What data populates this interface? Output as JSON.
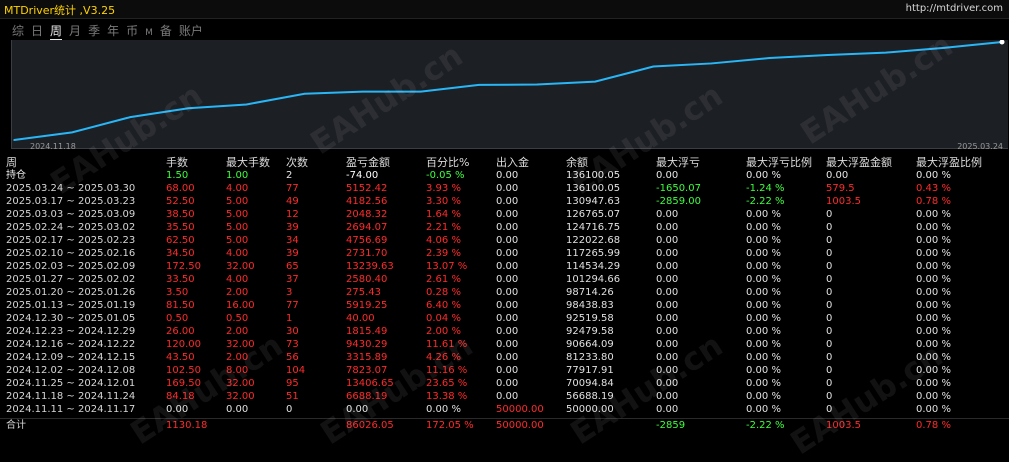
{
  "app": {
    "title": "MTDriver统计 ,V3.25",
    "url": "http://mtdriver.com"
  },
  "tabs": [
    {
      "label": "综",
      "active": false
    },
    {
      "label": "日",
      "active": false
    },
    {
      "label": "周",
      "active": true
    },
    {
      "label": "月",
      "active": false
    },
    {
      "label": "季",
      "active": false
    },
    {
      "label": "年",
      "active": false
    },
    {
      "label": "币",
      "active": false
    },
    {
      "label": "M",
      "active": false
    },
    {
      "label": "备",
      "active": false
    },
    {
      "label": "账户",
      "active": false
    }
  ],
  "chart_data": {
    "type": "line",
    "x_start_label": "2024.11.18",
    "x_end_label": "2025.03.24",
    "line_color": "#29b6f6",
    "background": "#1c1f24",
    "values": [
      50000.0,
      56688.19,
      70094.84,
      77917.91,
      81233.8,
      90664.09,
      92479.58,
      92519.58,
      98438.83,
      98714.26,
      101294.66,
      114534.29,
      117265.99,
      122022.68,
      124716.75,
      126765.07,
      130947.63,
      136100.05
    ]
  },
  "watermark": "EAHub.cn",
  "table": {
    "headers": [
      "周",
      "手数",
      "最大手数",
      "次数",
      "盈亏金额",
      "百分比%",
      "出入金",
      "余额",
      "最大浮亏",
      "最大浮亏比例",
      "最大浮盈金额",
      "最大浮盈比例"
    ],
    "holding": [
      "持仓",
      "1.50",
      "1.00",
      "2",
      "-74.00",
      "-0.05 %",
      "0.00",
      "136100.05",
      "0.00",
      "0.00 %",
      "0.00",
      "0.00 %"
    ],
    "rows": [
      [
        "2025.03.24 ~ 2025.03.30",
        "68.00",
        "4.00",
        "77",
        "5152.42",
        "3.93 %",
        "0.00",
        "136100.05",
        "-1650.07",
        "-1.24 %",
        "579.5",
        "0.43 %"
      ],
      [
        "2025.03.17 ~ 2025.03.23",
        "52.50",
        "5.00",
        "49",
        "4182.56",
        "3.30 %",
        "0.00",
        "130947.63",
        "-2859.00",
        "-2.22 %",
        "1003.5",
        "0.78 %"
      ],
      [
        "2025.03.03 ~ 2025.03.09",
        "38.50",
        "5.00",
        "12",
        "2048.32",
        "1.64 %",
        "0.00",
        "126765.07",
        "0.00",
        "0.00 %",
        "0",
        "0.00 %"
      ],
      [
        "2025.02.24 ~ 2025.03.02",
        "35.50",
        "5.00",
        "39",
        "2694.07",
        "2.21 %",
        "0.00",
        "124716.75",
        "0.00",
        "0.00 %",
        "0",
        "0.00 %"
      ],
      [
        "2025.02.17 ~ 2025.02.23",
        "62.50",
        "5.00",
        "34",
        "4756.69",
        "4.06 %",
        "0.00",
        "122022.68",
        "0.00",
        "0.00 %",
        "0",
        "0.00 %"
      ],
      [
        "2025.02.10 ~ 2025.02.16",
        "34.50",
        "4.00",
        "39",
        "2731.70",
        "2.39 %",
        "0.00",
        "117265.99",
        "0.00",
        "0.00 %",
        "0",
        "0.00 %"
      ],
      [
        "2025.02.03 ~ 2025.02.09",
        "172.50",
        "32.00",
        "65",
        "13239.63",
        "13.07 %",
        "0.00",
        "114534.29",
        "0.00",
        "0.00 %",
        "0",
        "0.00 %"
      ],
      [
        "2025.01.27 ~ 2025.02.02",
        "33.50",
        "4.00",
        "37",
        "2580.40",
        "2.61 %",
        "0.00",
        "101294.66",
        "0.00",
        "0.00 %",
        "0",
        "0.00 %"
      ],
      [
        "2025.01.20 ~ 2025.01.26",
        "3.50",
        "2.00",
        "3",
        "275.43",
        "0.28 %",
        "0.00",
        "98714.26",
        "0.00",
        "0.00 %",
        "0",
        "0.00 %"
      ],
      [
        "2025.01.13 ~ 2025.01.19",
        "81.50",
        "16.00",
        "77",
        "5919.25",
        "6.40 %",
        "0.00",
        "98438.83",
        "0.00",
        "0.00 %",
        "0",
        "0.00 %"
      ],
      [
        "2024.12.30 ~ 2025.01.05",
        "0.50",
        "0.50",
        "1",
        "40.00",
        "0.04 %",
        "0.00",
        "92519.58",
        "0.00",
        "0.00 %",
        "0",
        "0.00 %"
      ],
      [
        "2024.12.23 ~ 2024.12.29",
        "26.00",
        "2.00",
        "30",
        "1815.49",
        "2.00 %",
        "0.00",
        "92479.58",
        "0.00",
        "0.00 %",
        "0",
        "0.00 %"
      ],
      [
        "2024.12.16 ~ 2024.12.22",
        "120.00",
        "32.00",
        "73",
        "9430.29",
        "11.61 %",
        "0.00",
        "90664.09",
        "0.00",
        "0.00 %",
        "0",
        "0.00 %"
      ],
      [
        "2024.12.09 ~ 2024.12.15",
        "43.50",
        "2.00",
        "56",
        "3315.89",
        "4.26 %",
        "0.00",
        "81233.80",
        "0.00",
        "0.00 %",
        "0",
        "0.00 %"
      ],
      [
        "2024.12.02 ~ 2024.12.08",
        "102.50",
        "8.00",
        "104",
        "7823.07",
        "11.16 %",
        "0.00",
        "77917.91",
        "0.00",
        "0.00 %",
        "0",
        "0.00 %"
      ],
      [
        "2024.11.25 ~ 2024.12.01",
        "169.50",
        "32.00",
        "95",
        "13406.65",
        "23.65 %",
        "0.00",
        "70094.84",
        "0.00",
        "0.00 %",
        "0",
        "0.00 %"
      ],
      [
        "2024.11.18 ~ 2024.11.24",
        "84.18",
        "32.00",
        "51",
        "6688.19",
        "13.38 %",
        "0.00",
        "56688.19",
        "0.00",
        "0.00 %",
        "0",
        "0.00 %"
      ],
      [
        "2024.11.11 ~ 2024.11.17",
        "0.00",
        "0.00",
        "0",
        "0.00",
        "0.00 %",
        "50000.00",
        "50000.00",
        "0.00",
        "0.00 %",
        "0",
        "0.00 %"
      ]
    ],
    "total": [
      "合计",
      "1130.18",
      "",
      "",
      "86026.05",
      "172.05 %",
      "50000.00",
      "",
      "-2859",
      "-2.22 %",
      "1003.5",
      "0.78 %"
    ]
  }
}
